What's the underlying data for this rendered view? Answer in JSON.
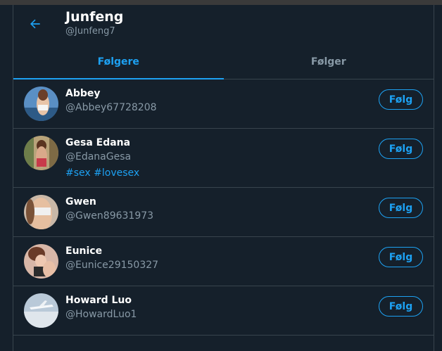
{
  "header": {
    "back_icon": "arrow-left-icon",
    "title": "Junfeng",
    "subtitle": "@Junfeng7"
  },
  "tabs": [
    {
      "label": "Følgere",
      "active": true
    },
    {
      "label": "Følger",
      "active": false
    }
  ],
  "users": [
    {
      "name": "Abbey",
      "handle": "@Abbey67728208",
      "button": "Følg",
      "bio": ""
    },
    {
      "name": "Gesa Edana",
      "handle": "@EdanaGesa",
      "button": "Følg",
      "bio_tags": [
        "#sex",
        "#lovesex"
      ]
    },
    {
      "name": "Gwen",
      "handle": "@Gwen89631973",
      "button": "Følg",
      "bio": ""
    },
    {
      "name": "Eunice",
      "handle": "@Eunice29150327",
      "button": "Følg",
      "bio": ""
    },
    {
      "name": "Howard Luo",
      "handle": "@HowardLuo1",
      "button": "Følg",
      "bio": ""
    }
  ],
  "colors": {
    "background": "#15202b",
    "accent": "#1da1f2",
    "secondary_text": "#8899a6",
    "border": "#38444d"
  }
}
